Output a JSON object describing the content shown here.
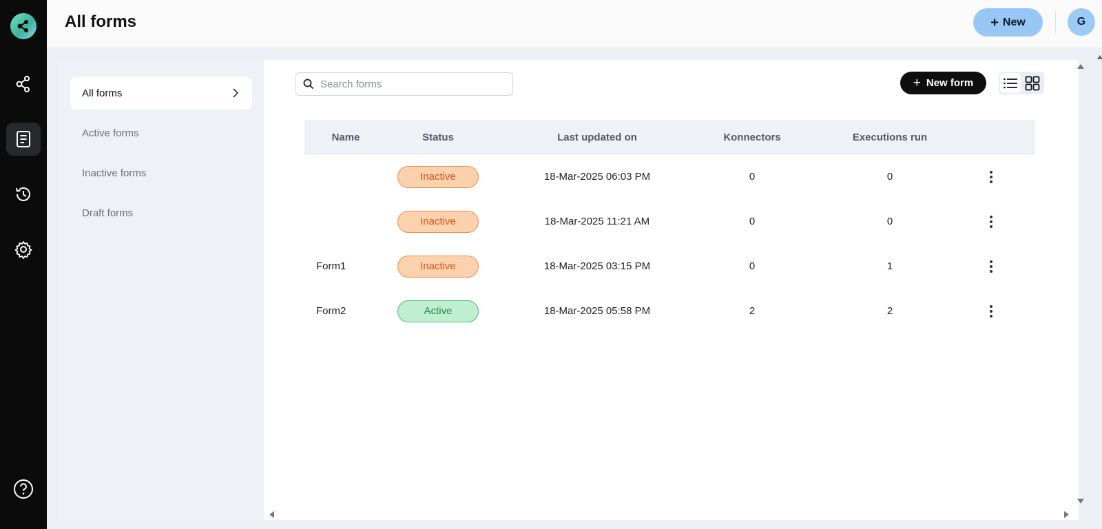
{
  "header": {
    "title": "All forms",
    "new_button": "New",
    "avatar_initial": "G"
  },
  "rail": {
    "items": [
      {
        "icon": "share-nodes-icon"
      },
      {
        "icon": "document-icon",
        "active": true
      },
      {
        "icon": "history-icon"
      },
      {
        "icon": "gear-icon"
      }
    ],
    "help_icon": "help-circle-icon"
  },
  "sidebar": {
    "items": [
      {
        "label": "All forms",
        "active": true
      },
      {
        "label": "Active forms"
      },
      {
        "label": "Inactive forms"
      },
      {
        "label": "Draft forms"
      }
    ]
  },
  "toolbar": {
    "search_placeholder": "Search forms",
    "new_form_label": "New form",
    "view_mode": "list"
  },
  "table": {
    "columns": [
      "Name",
      "Status",
      "Last updated on",
      "Konnectors",
      "Executions run"
    ],
    "rows": [
      {
        "name": "",
        "status": "Inactive",
        "updated": "18-Mar-2025 06:03 PM",
        "konnectors": "0",
        "executions": "0"
      },
      {
        "name": "",
        "status": "Inactive",
        "updated": "18-Mar-2025 11:21 AM",
        "konnectors": "0",
        "executions": "0"
      },
      {
        "name": "Form1",
        "status": "Inactive",
        "updated": "18-Mar-2025 03:15 PM",
        "konnectors": "0",
        "executions": "1"
      },
      {
        "name": "Form2",
        "status": "Active",
        "updated": "18-Mar-2025 05:58 PM",
        "konnectors": "2",
        "executions": "2"
      }
    ]
  },
  "colors": {
    "inactive_bg": "#fcd1ad",
    "inactive_border": "#ee8c4d",
    "inactive_text": "#d4581c",
    "active_bg": "#bfefd0",
    "active_border": "#4cbc74",
    "active_text": "#1f8a47"
  }
}
